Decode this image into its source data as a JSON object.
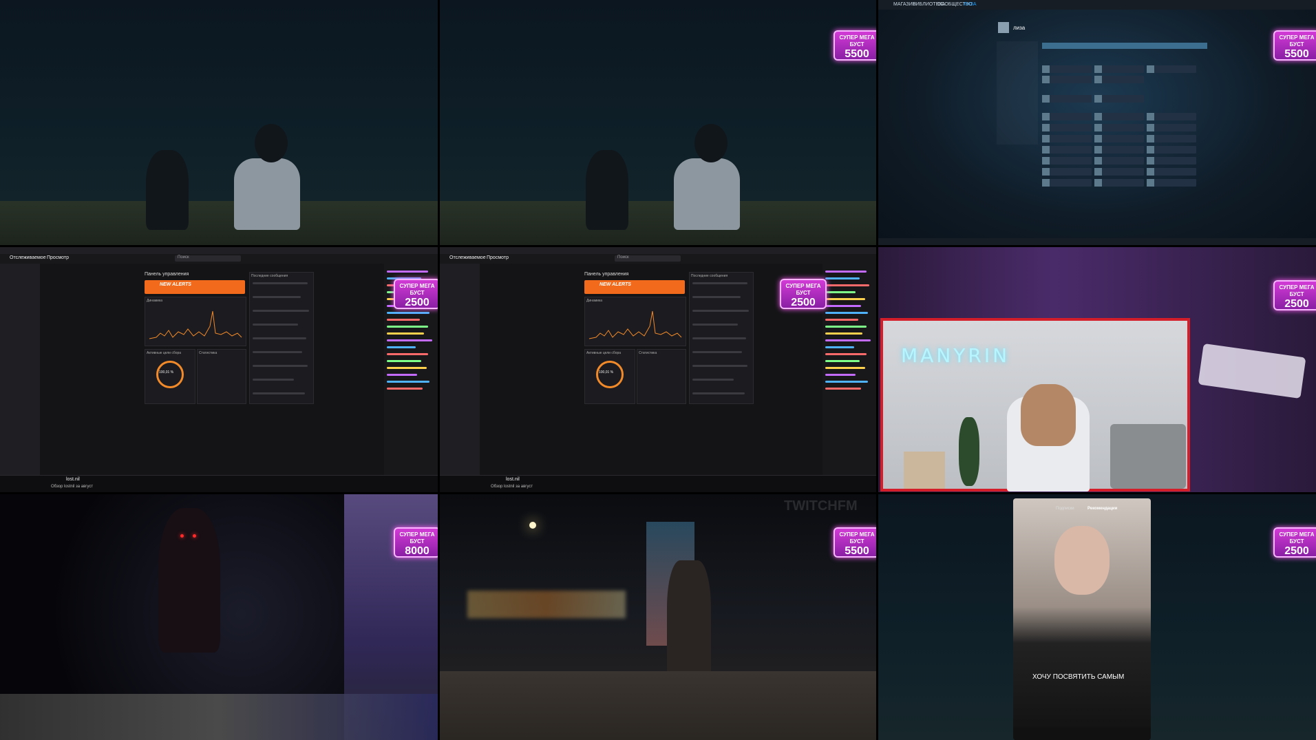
{
  "badges": {
    "mega_label": "СУПЕР МЕГА БУСТ",
    "value_5500": "5500",
    "value_2500": "2500",
    "value_8000": "8000"
  },
  "dashboard": {
    "tab_following": "Отслеживаемое",
    "tab_browse": "Просмотр",
    "search_placeholder": "Поиск",
    "panel_title": "Панель управления",
    "promo_label": "NEW ALERTS",
    "section_recent_messages": "Последние сообщения",
    "section_dynamics": "Динамика",
    "section_active_goals": "Активные цели сбора",
    "section_stats": "Статистика",
    "goal_percent": "100,01 %",
    "channel_name": "lost.nil",
    "bottom_caption": "Обзор lostnil за август"
  },
  "steam": {
    "menu": [
      "МАГАЗИН",
      "БИБЛИОТЕКА",
      "СООБЩЕСТВО",
      "ЛИЗА"
    ],
    "user_header": "лиза"
  },
  "webcam": {
    "neon_sign": "MANYRIN"
  },
  "tiktok": {
    "caption": "ХОЧУ ПОСВЯТИТЬ САМЫМ",
    "tabs": [
      "Подписки",
      "Рекомендации"
    ]
  },
  "watermarks": {
    "twitchfm": "TWITCHFM"
  }
}
